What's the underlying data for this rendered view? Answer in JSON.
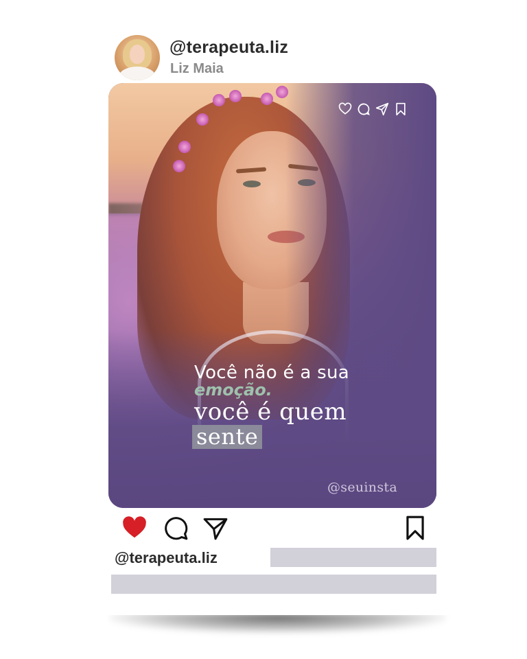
{
  "profile": {
    "handle": "@terapeuta.liz",
    "name": "Liz Maia"
  },
  "post": {
    "top_icons": [
      "heart-outline-icon",
      "comment-outline-icon",
      "send-outline-icon",
      "bookmark-outline-icon"
    ],
    "quote": {
      "line1": "Você não é a sua",
      "line2": "emoção.",
      "line3": "você é quem",
      "line4": "sente"
    },
    "watermark": "@seuinsta"
  },
  "actions": {
    "icons": [
      "heart-filled-icon",
      "comment-icon",
      "send-icon",
      "bookmark-icon"
    ],
    "like_color": "#d61f26"
  },
  "footer": {
    "handle": "@terapeuta.liz"
  },
  "colors": {
    "post_purple": "#5e4a84",
    "accent_green": "#9ec1ad",
    "placeholder_bar": "#d2d0d8"
  }
}
